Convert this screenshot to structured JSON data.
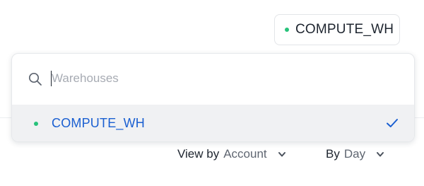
{
  "warehouse_button": {
    "label": "COMPUTE_WH",
    "status_color": "#27c27a"
  },
  "dropdown": {
    "search": {
      "placeholder": "Warehouses",
      "value": "",
      "icon": "search-icon"
    },
    "options": [
      {
        "label": "COMPUTE_WH",
        "selected": true,
        "status_color": "#27c27a",
        "label_color": "#1a5fd1",
        "selected_icon": "check-icon"
      }
    ]
  },
  "controls": {
    "view_by": {
      "prefix": "View by",
      "value": "Account",
      "icon": "chevron-down-icon"
    },
    "period": {
      "prefix": "By",
      "value": "Day",
      "icon": "chevron-down-icon"
    }
  },
  "colors": {
    "accent": "#1a5fd1",
    "status_ok": "#27c27a",
    "selected_row_bg": "#f0f1f3"
  }
}
